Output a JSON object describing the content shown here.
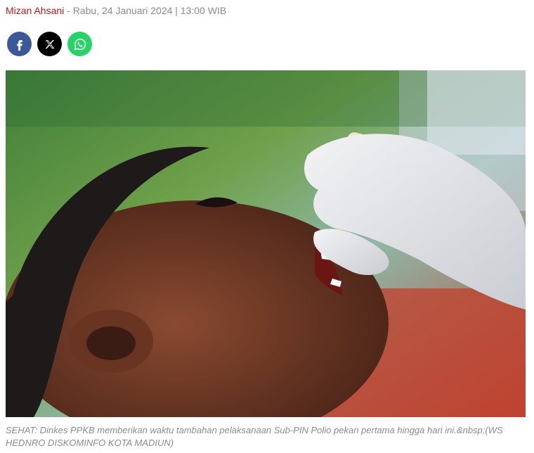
{
  "byline": {
    "author": "Mizan Ahsani",
    "separator": " - ",
    "date": "Rabu, 24 Januari 2024 | 13:00 WIB"
  },
  "share": {
    "buttons": [
      {
        "icon": "facebook-icon",
        "color": "#3b5998"
      },
      {
        "icon": "x-icon",
        "color": "#000000"
      },
      {
        "icon": "whatsapp-icon",
        "color": "#25d366"
      }
    ]
  },
  "photo": {
    "subject": "child receiving oral polio vaccine drops from a gloved hand"
  },
  "caption": {
    "text": "SEHAT: Dinkes PPKB memberikan waktu tambahan pelaksanaan Sub-PIN Polio pekan pertama hingga hari ini.&nbsp;(WS HEDNRO DISKOMINFO KOTA MADIUN)"
  }
}
